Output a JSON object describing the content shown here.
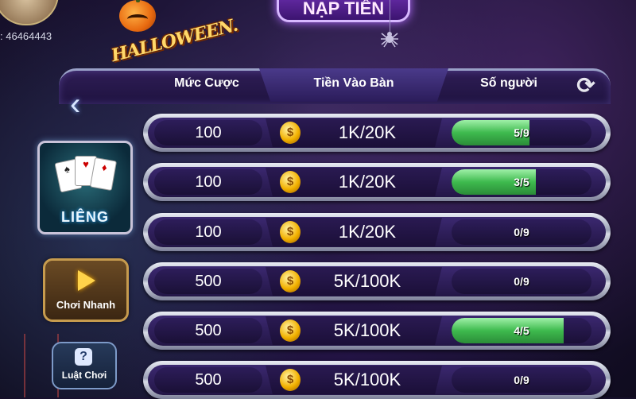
{
  "account": {
    "id": ": 46464443"
  },
  "event": {
    "logo_text": "HALLOWEEN."
  },
  "banner": {
    "title": "NẠP TIỀN"
  },
  "header": {
    "col_bet": "Mức Cược",
    "col_entry": "Tiền Vào Bàn",
    "col_players": "Số người"
  },
  "side": {
    "game_label": "LIÊNG",
    "quick_play": "Chơi Nhanh",
    "rules": "Luật Chơi"
  },
  "icons": {
    "back": "chevron-left-icon",
    "refresh": "refresh-icon",
    "play": "play-icon",
    "help": "question-icon",
    "coin": "coin-icon"
  },
  "colors": {
    "progress_fill": "#3eba4e",
    "coin": "#f2b100",
    "panel": "#231646"
  },
  "rows": [
    {
      "bet": "100",
      "entry": "1K/20K",
      "players": "5/9",
      "fill": 0.5556
    },
    {
      "bet": "100",
      "entry": "1K/20K",
      "players": "3/5",
      "fill": 0.6
    },
    {
      "bet": "100",
      "entry": "1K/20K",
      "players": "0/9",
      "fill": 0
    },
    {
      "bet": "500",
      "entry": "5K/100K",
      "players": "0/9",
      "fill": 0
    },
    {
      "bet": "500",
      "entry": "5K/100K",
      "players": "4/5",
      "fill": 0.8
    },
    {
      "bet": "500",
      "entry": "5K/100K",
      "players": "0/9",
      "fill": 0
    }
  ]
}
